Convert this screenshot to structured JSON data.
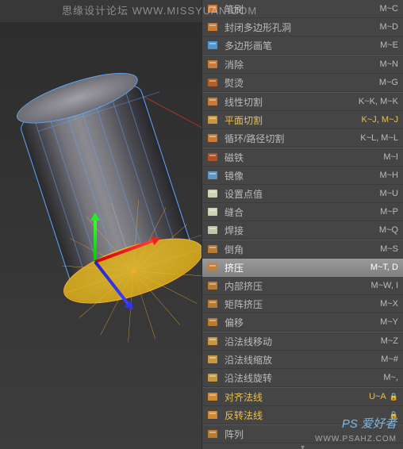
{
  "watermarks": {
    "top": "思缘设计论坛  WWW.MISSYUAN.COM",
    "bottom_main": "PS 爱好者",
    "bottom_sub": "WWW.PSAHZ.COM"
  },
  "menu": [
    {
      "icon": "brush-icon",
      "label": "笔刷",
      "shortcut": "M~C",
      "sep": false,
      "yellow": false,
      "hl": false,
      "arrow": false
    },
    {
      "icon": "close-poly-icon",
      "label": "封闭多边形孔洞",
      "shortcut": "M~D",
      "sep": false,
      "yellow": false,
      "hl": false,
      "arrow": false
    },
    {
      "icon": "poly-pen-icon",
      "label": "多边形画笔",
      "shortcut": "M~E",
      "sep": true,
      "yellow": false,
      "hl": false,
      "arrow": false
    },
    {
      "icon": "dissolve-icon",
      "label": "消除",
      "shortcut": "M~N",
      "sep": false,
      "yellow": false,
      "hl": false,
      "arrow": false
    },
    {
      "icon": "iron-icon",
      "label": "熨烫",
      "shortcut": "M~G",
      "sep": true,
      "yellow": false,
      "hl": false,
      "arrow": false
    },
    {
      "icon": "knife-icon",
      "label": "线性切割",
      "shortcut": "K~K, M~K",
      "sep": false,
      "yellow": false,
      "hl": false,
      "arrow": false
    },
    {
      "icon": "plane-cut-icon",
      "label": "平面切割",
      "shortcut": "K~J, M~J",
      "sep": false,
      "yellow": true,
      "hl": false,
      "arrow": false
    },
    {
      "icon": "loop-cut-icon",
      "label": "循环/路径切割",
      "shortcut": "K~L, M~L",
      "sep": true,
      "yellow": false,
      "hl": false,
      "arrow": false
    },
    {
      "icon": "magnet-icon",
      "label": "磁铁",
      "shortcut": "M~I",
      "sep": false,
      "yellow": false,
      "hl": false,
      "arrow": false
    },
    {
      "icon": "mirror-icon",
      "label": "镜像",
      "shortcut": "M~H",
      "sep": false,
      "yellow": false,
      "hl": false,
      "arrow": false
    },
    {
      "icon": "set-point-icon",
      "label": "设置点值",
      "shortcut": "M~U",
      "sep": false,
      "yellow": false,
      "hl": false,
      "arrow": false
    },
    {
      "icon": "stitch-icon",
      "label": "缝合",
      "shortcut": "M~P",
      "sep": false,
      "yellow": false,
      "hl": false,
      "arrow": false
    },
    {
      "icon": "weld-icon",
      "label": "焊接",
      "shortcut": "M~Q",
      "sep": true,
      "yellow": false,
      "hl": false,
      "arrow": false
    },
    {
      "icon": "bevel-icon",
      "label": "倒角",
      "shortcut": "M~S",
      "sep": false,
      "yellow": false,
      "hl": false,
      "arrow": false
    },
    {
      "icon": "extrude-icon",
      "label": "挤压",
      "shortcut": "M~T, D",
      "sep": false,
      "yellow": false,
      "hl": true,
      "arrow": false
    },
    {
      "icon": "inner-ext-icon",
      "label": "内部挤压",
      "shortcut": "M~W, I",
      "sep": false,
      "yellow": false,
      "hl": false,
      "arrow": false
    },
    {
      "icon": "matrix-ext-icon",
      "label": "矩阵挤压",
      "shortcut": "M~X",
      "sep": false,
      "yellow": false,
      "hl": false,
      "arrow": false
    },
    {
      "icon": "offset-icon",
      "label": "偏移",
      "shortcut": "M~Y",
      "sep": true,
      "yellow": false,
      "hl": false,
      "arrow": false
    },
    {
      "icon": "normal-move-icon",
      "label": "沿法线移动",
      "shortcut": "M~Z",
      "sep": false,
      "yellow": false,
      "hl": false,
      "arrow": false
    },
    {
      "icon": "normal-scale-icon",
      "label": "沿法线缩放",
      "shortcut": "M~#",
      "sep": false,
      "yellow": false,
      "hl": false,
      "arrow": false
    },
    {
      "icon": "normal-rot-icon",
      "label": "沿法线旋转",
      "shortcut": "M~,",
      "sep": true,
      "yellow": false,
      "hl": false,
      "arrow": false
    },
    {
      "icon": "align-norm-icon",
      "label": "对齐法线",
      "shortcut": "U~A",
      "sep": false,
      "yellow": true,
      "hl": false,
      "arrow": true
    },
    {
      "icon": "flip-norm-icon",
      "label": "反转法线",
      "shortcut": "",
      "sep": true,
      "yellow": true,
      "hl": false,
      "arrow": true
    },
    {
      "icon": "array-icon",
      "label": "阵列",
      "shortcut": "",
      "sep": false,
      "yellow": false,
      "hl": false,
      "arrow": false
    }
  ]
}
